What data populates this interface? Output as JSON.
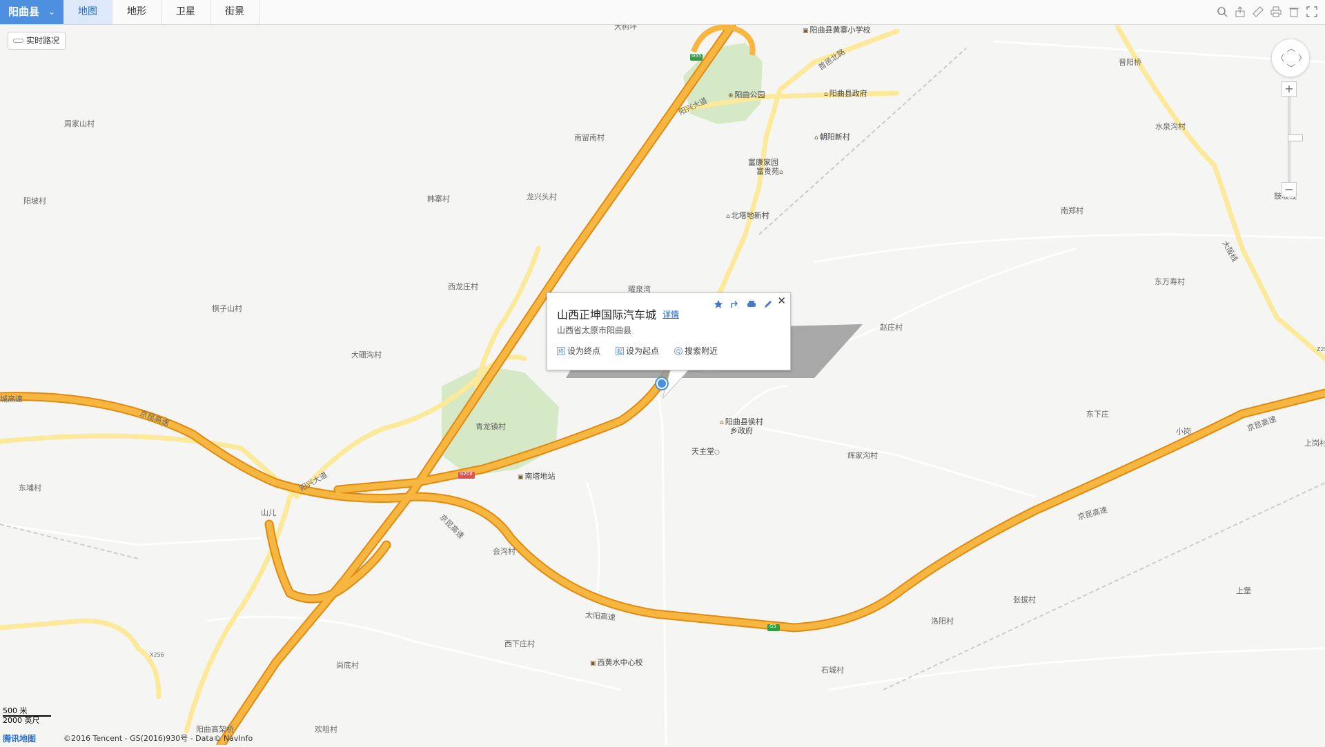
{
  "toolbar": {
    "region": "阳曲县",
    "region_chevron": "chevron-down",
    "tabs": [
      "地图",
      "地形",
      "卫星",
      "街景"
    ],
    "active_tab": "地图",
    "tools": [
      "search-icon",
      "share-icon",
      "ruler-icon",
      "print-icon",
      "clear-icon",
      "fullscreen-icon"
    ]
  },
  "traffic_button": {
    "label": "实时路况"
  },
  "popup": {
    "title": "山西正坤国际汽车城",
    "detail_link": "详情",
    "address": "山西省太原市阳曲县",
    "actions": [
      {
        "icon": "终",
        "label": "设为终点"
      },
      {
        "icon": "起",
        "label": "设为起点"
      },
      {
        "icon": "Q",
        "label": "搜索附近"
      }
    ],
    "icons": [
      "star-icon",
      "share-icon",
      "car-icon",
      "edit-icon"
    ],
    "close": "✕"
  },
  "map_labels": {
    "places": [
      "大树坪",
      "周家山村",
      "阳坡村",
      "南留南村",
      "韩寨村",
      "龙兴头村",
      "西龙庄村",
      "棋子山村",
      "大硼沟村",
      "青龙镇村",
      "赵庄村",
      "东下庄",
      "小岗",
      "上岗村",
      "辉家沟村",
      "东埔村",
      "会沟村",
      "西下庄村",
      "尚底村",
      "欢咀村",
      "洛阳村",
      "张拔村",
      "石城村",
      "上堡",
      "晋阳桥",
      "水泉沟村",
      "南郑村",
      "东万寿村",
      "富康家园富贵苑",
      "曜泉湾",
      "山儿",
      "阳曲高架桥"
    ],
    "pois": [
      "阳曲县黄寨小学校",
      "阳曲公园",
      "阳曲县政府",
      "朝阳新村",
      "富康家园",
      "富贵苑",
      "北塔地新村",
      "阳曲县侯村",
      "乡政府",
      "天主堂",
      "南塔地站",
      "西黄水中心校"
    ],
    "roads": [
      "阳兴大道",
      "首邑北路",
      "京昆高速",
      "太阳高速",
      "大阪线",
      "阳兴大道",
      "太原绕城高速",
      "城高速",
      "X256",
      "Z25",
      "鼓坂线"
    ],
    "road_shields": [
      "G55",
      "G5",
      "G208"
    ]
  },
  "scale": {
    "metric": "500 米",
    "imperial": "2000 英尺"
  },
  "footer": {
    "logo": "腾讯地图",
    "copyright": "©2016 Tencent - GS(2016)930号 - Data© NavInfo"
  },
  "colors": {
    "highway": "#f5a623",
    "highway_border": "#e08a10",
    "road": "#fde99a",
    "minor_road": "#ffffff",
    "park": "#d5e9c6",
    "background": "#f5f5f3",
    "accent": "#4e90e0"
  }
}
